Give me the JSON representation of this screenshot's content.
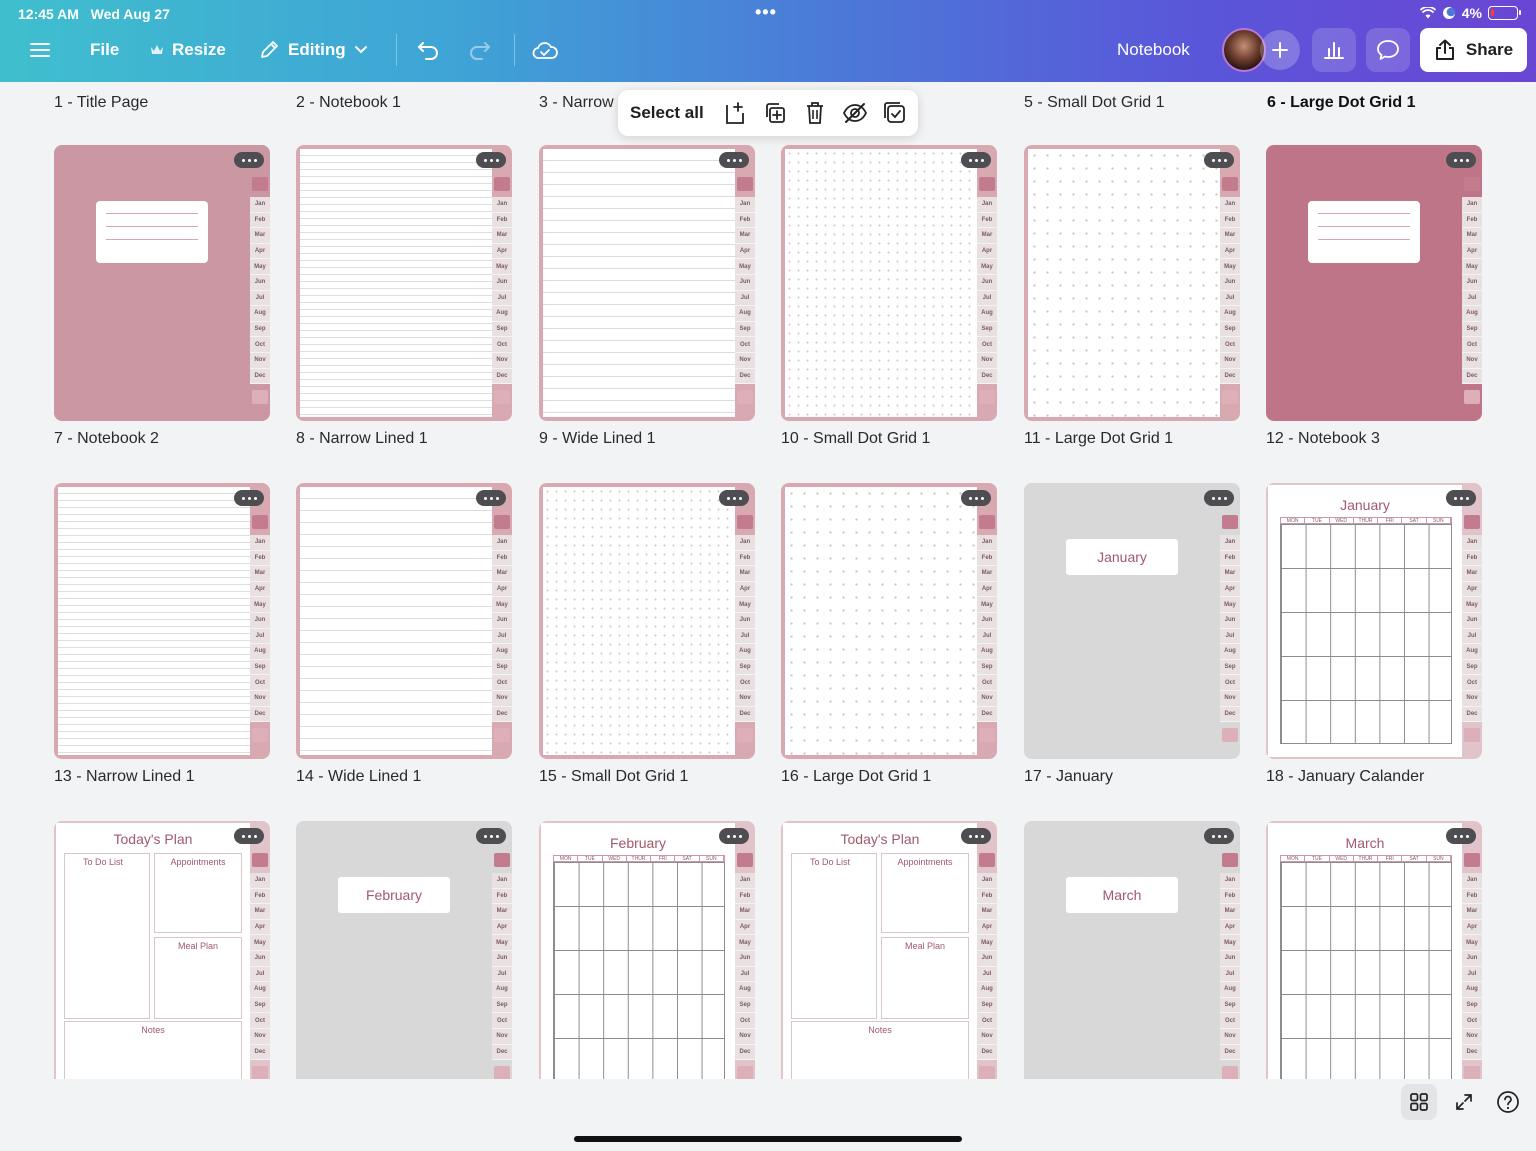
{
  "status": {
    "time": "12:45 AM",
    "date": "Wed Aug 27",
    "battery": "4%"
  },
  "toolbar": {
    "file": "File",
    "resize": "Resize",
    "editing": "Editing",
    "doc_title": "Notebook",
    "share": "Share"
  },
  "selection_bar": {
    "select_all": "Select all"
  },
  "tab_months": [
    "Jan",
    "Feb",
    "Mar",
    "Apr",
    "May",
    "Jun",
    "Jul",
    "Aug",
    "Sep",
    "Oct",
    "Nov",
    "Dec"
  ],
  "top_labels": [
    "1 - Title Page",
    "2 - Notebook 1",
    "3 - Narrow",
    "5 - Small Dot Grid 1",
    "6 - Large Dot Grid 1"
  ],
  "pages": [
    {
      "label": "7 - Notebook 2",
      "kind": "cover"
    },
    {
      "label": "8 - Narrow Lined 1",
      "kind": "narrow"
    },
    {
      "label": "9 - Wide Lined 1",
      "kind": "wide"
    },
    {
      "label": "10 - Small Dot Grid 1",
      "kind": "sdot"
    },
    {
      "label": "11 - Large Dot Grid 1",
      "kind": "ldot"
    },
    {
      "label": "12 - Notebook 3",
      "kind": "cover-dark"
    },
    {
      "label": "13 - Narrow Lined 1",
      "kind": "narrow"
    },
    {
      "label": "14 - Wide Lined 1",
      "kind": "wide"
    },
    {
      "label": "15 - Small Dot Grid 1",
      "kind": "sdot"
    },
    {
      "label": "16 - Large Dot Grid 1",
      "kind": "ldot"
    },
    {
      "label": "17 - January",
      "kind": "month",
      "month": "January"
    },
    {
      "label": "18 - January Calander",
      "kind": "calendar",
      "month": "January"
    },
    {
      "label": "",
      "kind": "plan"
    },
    {
      "label": "",
      "kind": "month",
      "month": "February"
    },
    {
      "label": "",
      "kind": "calendar",
      "month": "February"
    },
    {
      "label": "",
      "kind": "plan"
    },
    {
      "label": "",
      "kind": "month",
      "month": "March"
    },
    {
      "label": "",
      "kind": "calendar",
      "month": "March"
    }
  ],
  "calendar_days": [
    "MON",
    "TUE",
    "WED",
    "THUR",
    "FRI",
    "SAT",
    "SUN"
  ],
  "plan": {
    "title": "Today's Plan",
    "todo": "To Do List",
    "appointments": "Appointments",
    "meal": "Meal Plan",
    "notes": "Notes"
  }
}
